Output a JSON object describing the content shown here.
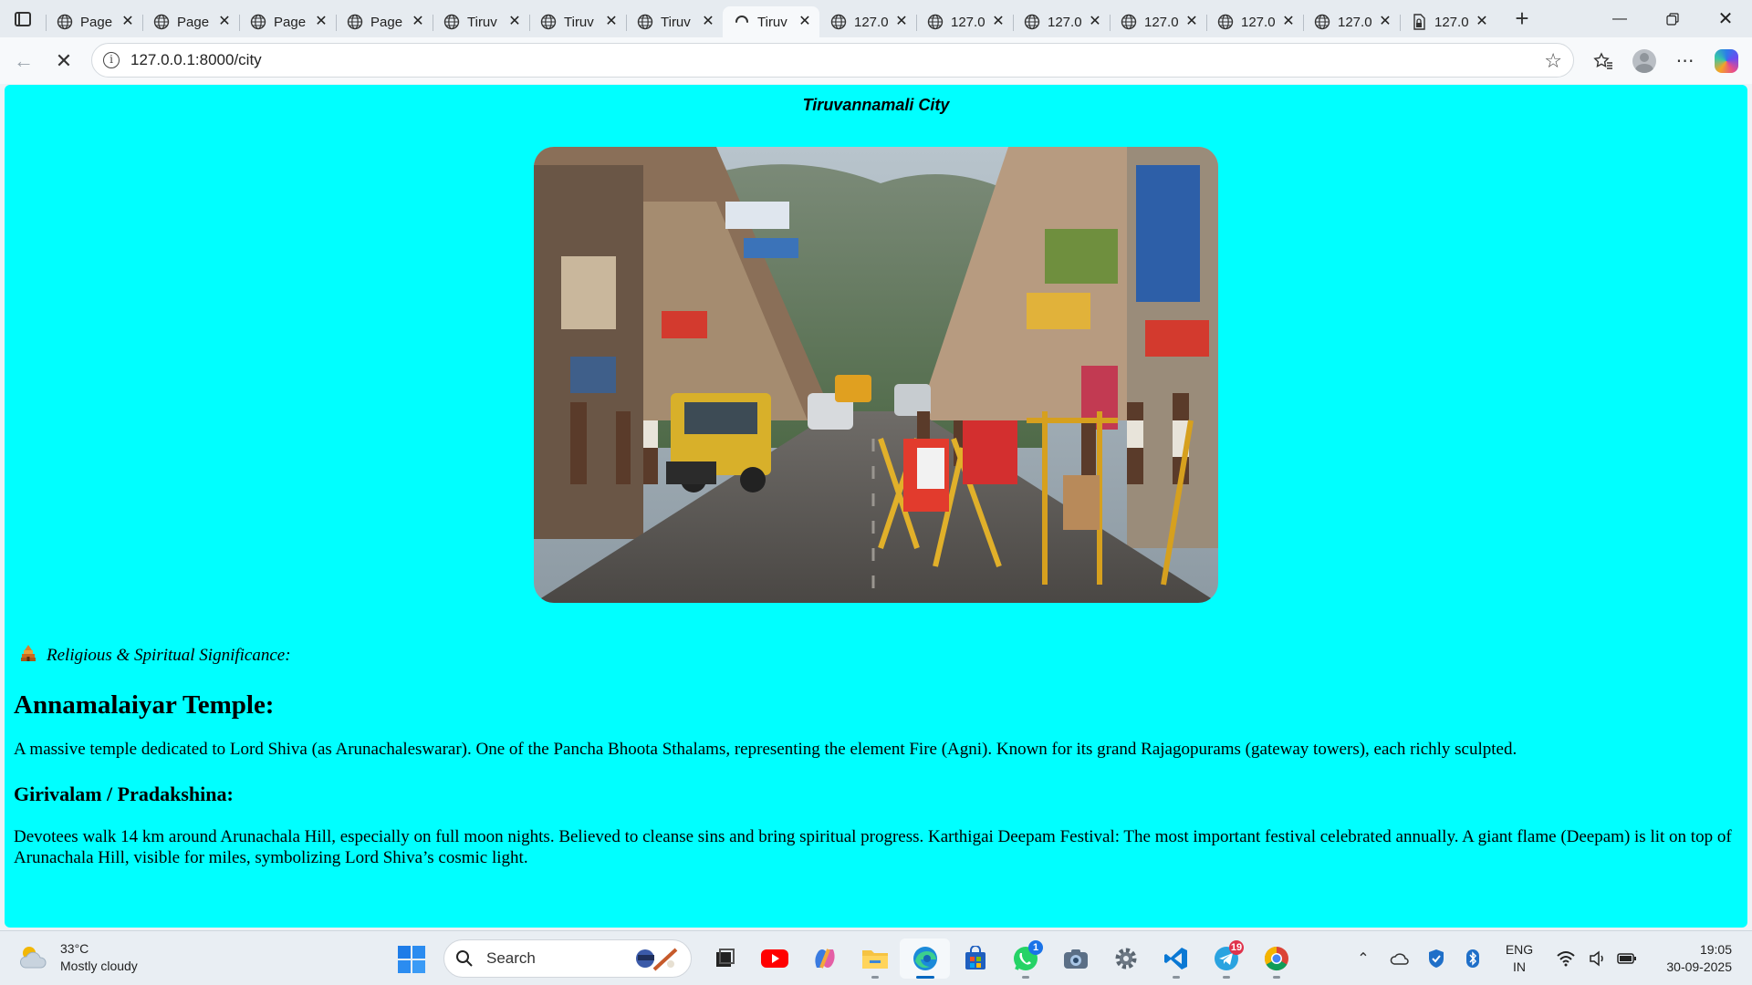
{
  "browser": {
    "tabs": [
      {
        "label": "Page",
        "icon": "globe-icon"
      },
      {
        "label": "Page",
        "icon": "globe-icon"
      },
      {
        "label": "Page",
        "icon": "globe-icon"
      },
      {
        "label": "Page",
        "icon": "globe-icon"
      },
      {
        "label": "Tiruv",
        "icon": "globe-icon"
      },
      {
        "label": "Tiruv",
        "icon": "globe-icon"
      },
      {
        "label": "Tiruv",
        "icon": "globe-icon"
      },
      {
        "label": "Tiruv",
        "icon": "loading-icon",
        "active": true
      },
      {
        "label": "127.0",
        "icon": "globe-icon"
      },
      {
        "label": "127.0",
        "icon": "globe-icon"
      },
      {
        "label": "127.0",
        "icon": "globe-icon"
      },
      {
        "label": "127.0",
        "icon": "globe-icon"
      },
      {
        "label": "127.0",
        "icon": "globe-icon"
      },
      {
        "label": "127.0",
        "icon": "globe-icon"
      },
      {
        "label": "127.0",
        "icon": "file-lock-icon"
      }
    ],
    "address": {
      "url": "127.0.0.1:8000/city"
    }
  },
  "page": {
    "title": "Tiruvannamali City",
    "hero_image": {
      "description": "Busy street in Tiruvannamalai with shops, vehicles, crowd and hill in background"
    },
    "subtitle": "Religious & Spiritual Significance:",
    "temple_heading": "Annamalaiyar Temple:",
    "temple_text": "A massive temple dedicated to Lord Shiva (as Arunachaleswarar). One of the Pancha Bhoota Sthalams, representing the element Fire (Agni). Known for its grand Rajagopurams (gateway towers), each richly sculpted.",
    "girivalam_heading": "Girivalam / Pradakshina:",
    "girivalam_text": "Devotees walk 14 km around Arunachala Hill, especially on full moon nights. Believed to cleanse sins and bring spiritual progress. Karthigai Deepam Festival: The most important festival celebrated annually. A giant flame (Deepam) is lit on top of Arunachala Hill, visible for miles, symbolizing Lord Shiva’s cosmic light."
  },
  "taskbar": {
    "weather": {
      "temp": "33°C",
      "condition": "Mostly cloudy"
    },
    "search_placeholder": "Search",
    "apps": [
      {
        "name": "taskview-app"
      },
      {
        "name": "youtube-app"
      },
      {
        "name": "copilot-app"
      },
      {
        "name": "file-explorer-app"
      },
      {
        "name": "edge-app",
        "active": true
      },
      {
        "name": "store-app"
      },
      {
        "name": "whatsapp-app",
        "badge": "1"
      },
      {
        "name": "camera-app"
      },
      {
        "name": "settings-app"
      },
      {
        "name": "vscode-app"
      },
      {
        "name": "telegram-app",
        "badge": "19"
      },
      {
        "name": "chrome-app"
      }
    ],
    "lang": {
      "line1": "ENG",
      "line2": "IN"
    },
    "clock": {
      "time": "19:05",
      "date": "30-09-2025"
    }
  },
  "colors": {
    "page_background": "#00ffff",
    "accent": "#0067c0"
  }
}
